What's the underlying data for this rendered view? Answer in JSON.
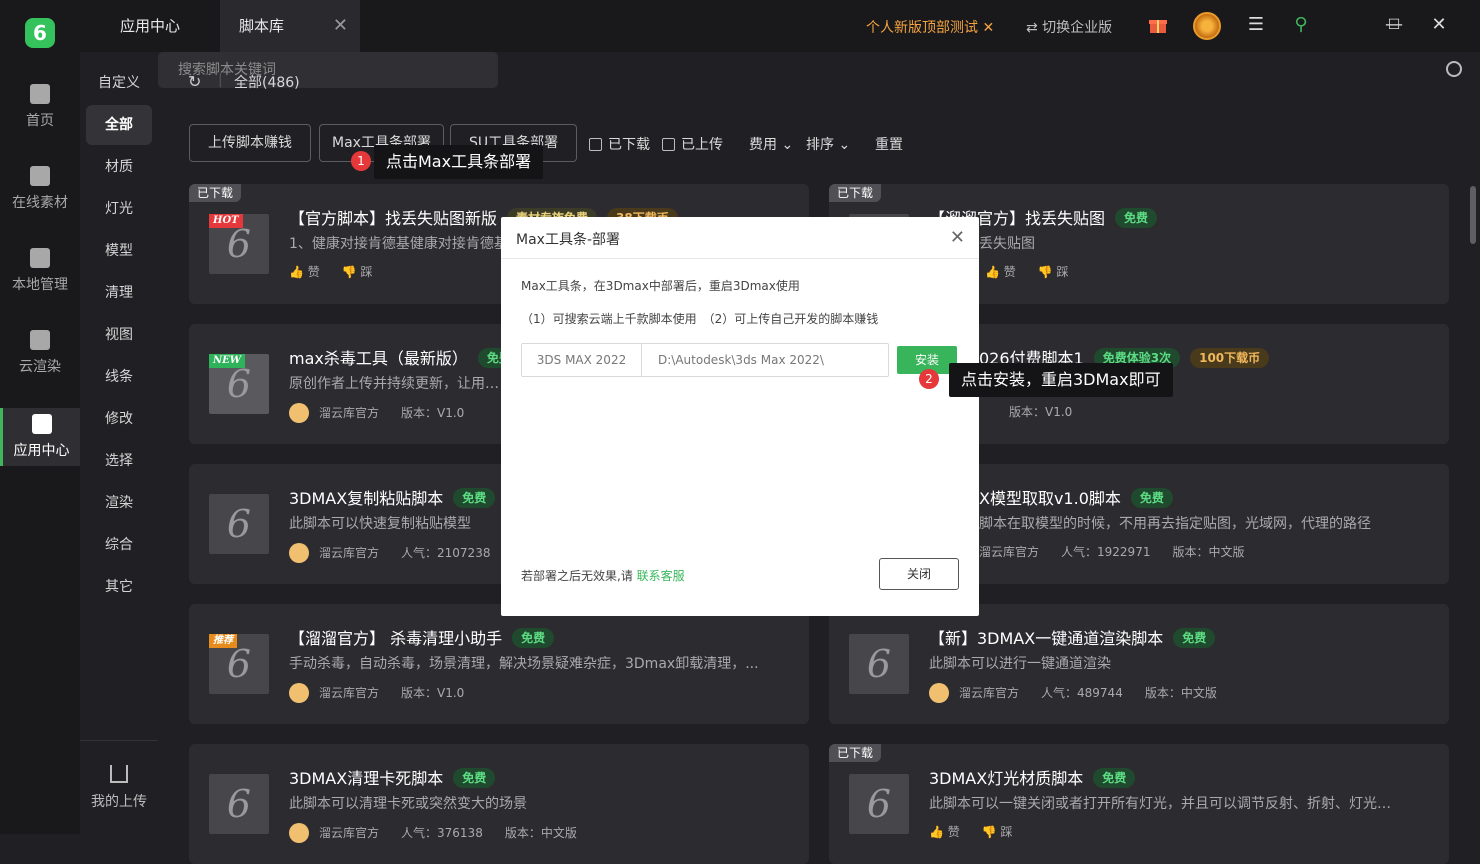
{
  "topbar": {
    "app_tab": "应用中心",
    "script_tab": "脚本库",
    "promo": "个人新版顶部测试",
    "switch": "⇄ 切换企业版"
  },
  "rail": [
    {
      "label": "首页",
      "icon": "home-icon"
    },
    {
      "label": "在线素材",
      "icon": "grid-icon"
    },
    {
      "label": "本地管理",
      "icon": "monitor-icon"
    },
    {
      "label": "云渲染",
      "icon": "cloud-icon"
    },
    {
      "label": "应用中心",
      "icon": "apps-icon"
    }
  ],
  "categories": [
    "自定义",
    "全部",
    "材质",
    "灯光",
    "模型",
    "清理",
    "视图",
    "线条",
    "修改",
    "选择",
    "渲染",
    "综合",
    "其它"
  ],
  "my_upload": "我的上传",
  "breadcrumb": "全部(486)",
  "toolbar": {
    "upload": "上传脚本赚钱",
    "max_deploy": "Max工具条部署",
    "su_deploy": "SU工具条部署",
    "downloaded": "已下载",
    "uploaded": "已上传",
    "fee": "费用",
    "sort": "排序",
    "reset": "重置",
    "search_placeholder": "搜索脚本关键词"
  },
  "cards": [
    {
      "title": "【官方脚本】找丢失贴图新版",
      "badges": [
        "素材专族免费",
        "38下载币"
      ],
      "desc": "1、健康对接肯德基健康对接肯德基",
      "meta": [
        "赞",
        "踩"
      ],
      "downloaded": "已下载",
      "ribbon": "HOT"
    },
    {
      "title": "【溜溜官方】找丢失贴图",
      "badges": [
        "免费"
      ],
      "desc": "丢失贴图",
      "meta": [
        "赞",
        "踩"
      ],
      "downloaded": "已下载"
    },
    {
      "title": "max杀毒工具（最新版）",
      "badges": [
        "免费"
      ],
      "desc": "原创作者上传并持续更新，让用户用",
      "meta": [
        "溜云库官方",
        "版本：V1.0"
      ],
      "ribbon": "NEW"
    },
    {
      "title": "026付费脚本1",
      "badges": [
        "免费体验3次",
        "100下载币"
      ],
      "desc": "",
      "meta": [
        "版本：V1.0"
      ]
    },
    {
      "title": "3DMAX复制粘贴脚本",
      "badges": [
        "免费"
      ],
      "desc": "此脚本可以快速复制粘贴模型",
      "meta": [
        "溜云库官方",
        "人气：2107238"
      ]
    },
    {
      "title": "X模型取取v1.0脚本",
      "badges": [
        "免费"
      ],
      "desc": "脚本在取模型的时候，不用再去指定贴图，光域网，代理的路径",
      "meta": [
        "溜云库官方",
        "人气：1922971",
        "版本：中文版"
      ]
    },
    {
      "title": "【溜溜官方】 杀毒清理小助手",
      "badges": [
        "免费"
      ],
      "desc": "手动杀毒，自动杀毒，场景清理，解决场景疑难杂症，3Dmax卸载清理，...",
      "meta": [
        "溜云库官方",
        "版本：V1.0"
      ],
      "ribbon": "推荐"
    },
    {
      "title": "【新】3DMAX一键通道渲染脚本",
      "badges": [
        "免费"
      ],
      "desc": "此脚本可以进行一键通道渲染",
      "meta": [
        "溜云库官方",
        "人气：489744",
        "版本：中文版"
      ]
    },
    {
      "title": "3DMAX清理卡死脚本",
      "badges": [
        "免费"
      ],
      "desc": "此脚本可以清理卡死或突然变大的场景",
      "meta": [
        "溜云库官方",
        "人气：376138",
        "版本：中文版"
      ]
    },
    {
      "title": "3DMAX灯光材质脚本",
      "badges": [
        "免费"
      ],
      "desc": "此脚本可以一键关闭或者打开所有灯光，并且可以调节反射、折射、灯光细分...",
      "meta": [
        "赞",
        "踩"
      ],
      "downloaded": "已下载"
    }
  ],
  "tips": {
    "tip1_num": "1",
    "tip1": "点击Max工具条部署",
    "tip2_num": "2",
    "tip2": "点击安装，重启3DMax即可"
  },
  "dialog": {
    "title": "Max工具条-部署",
    "line1": "Max工具条，在3Dmax中部署后，重启3Dmax使用",
    "line2": "（1）可搜索云端上千款脚本使用　（2）可上传自己开发的脚本赚钱",
    "version": "3DS MAX 2022",
    "path": "D:\\Autodesk\\3ds Max 2022\\",
    "install": "安装",
    "footnote": "若部署之后无效果,请",
    "contact": "联系客服",
    "close": "关闭"
  },
  "colors": {
    "accent": "#38b55a",
    "promo": "#f4a340",
    "free_badge": "#5ddc83"
  }
}
